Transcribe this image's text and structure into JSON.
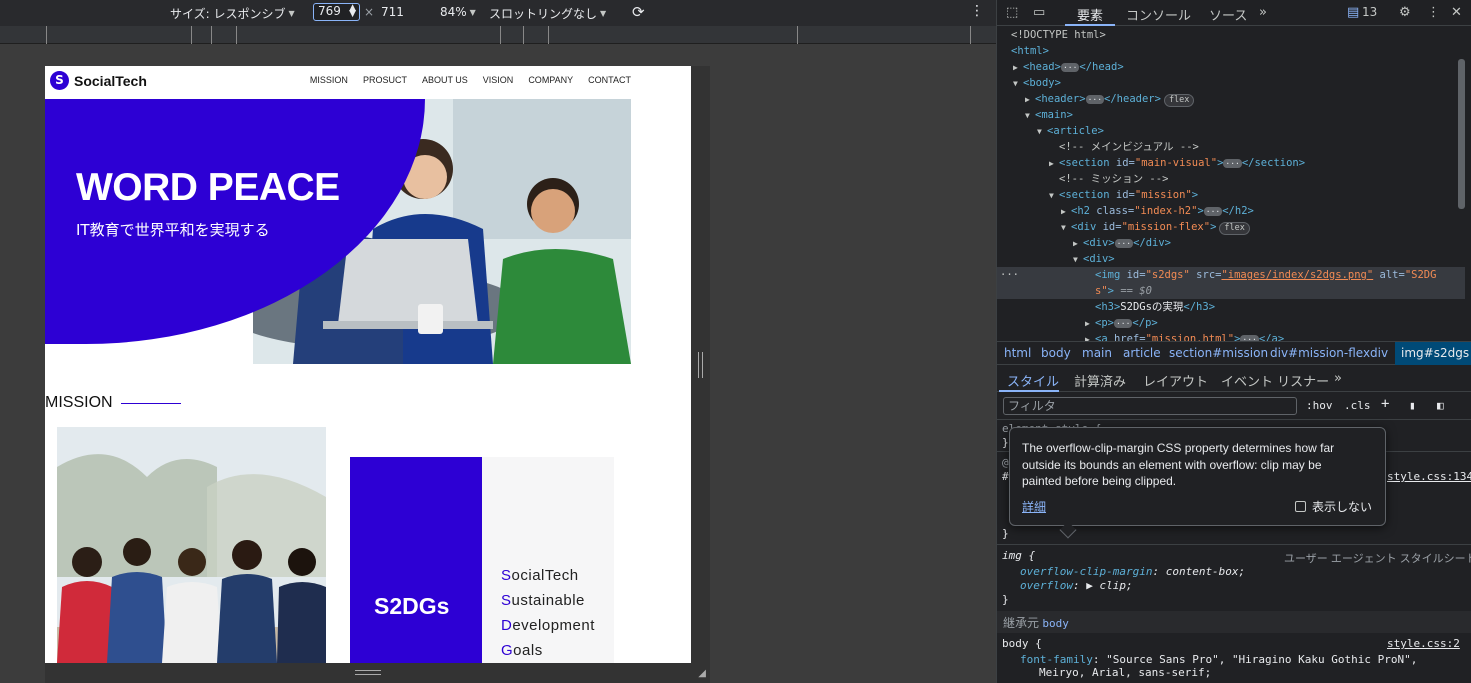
{
  "device_toolbar": {
    "size_label": "サイズ: レスポンシブ",
    "width": "769",
    "height": "711",
    "zoom": "84%",
    "throttle": "スロットリングなし"
  },
  "site": {
    "logo_text": "SocialTech",
    "nav": [
      "MISSION",
      "PROSUCT",
      "ABOUT US",
      "VISION",
      "COMPANY",
      "CONTACT"
    ],
    "hero_title": "WORD PEACE",
    "hero_subtitle": "IT教育で世界平和を実現する",
    "section_title": "MISSION",
    "sdg_title": "S2DGs",
    "sdg_lines": [
      {
        "first": "S",
        "rest": "ocialTech"
      },
      {
        "first": "S",
        "rest": "ustainable"
      },
      {
        "first": "D",
        "rest": "evelopment"
      },
      {
        "first": "G",
        "rest": "oals"
      }
    ]
  },
  "devtools": {
    "tabs": [
      "要素",
      "コンソール",
      "ソース"
    ],
    "issues_count": "13",
    "dom": {
      "doctype": "<!DOCTYPE html>",
      "comment_main_visual": "<!-- メインビジュアル -->",
      "comment_mission": "<!-- ミッション -->",
      "h3_text": "S2DGsの実現",
      "selected_suffix": "== $0"
    },
    "breadcrumbs": [
      "html",
      "body",
      "main",
      "article",
      "section#mission",
      "div#mission-flex",
      "div",
      "img#s2dgs"
    ],
    "sub_tabs": [
      "スタイル",
      "計算済み",
      "レイアウト",
      "イベント リスナー"
    ],
    "filter_placeholder": "フィルタ",
    "hov": ":hov",
    "cls": ".cls",
    "styles": {
      "element_style": "element.style {",
      "src1": "style.css:134",
      "img_selector": "img {",
      "ua_label": "ユーザー エージェント スタイルシート",
      "prop1": "overflow-clip-margin",
      "val1": "content-box;",
      "prop2": "overflow",
      "val2": "clip;",
      "inherited_label": "継承元",
      "inherited_from": "body",
      "body_selector": "body {",
      "src2": "style.css:2",
      "font_prop": "font-family",
      "font_val1": "\"Source Sans Pro\", \"Hiragino Kaku Gothic ProN\",",
      "font_val2": "Meiryo, Arial, sans-serif;"
    },
    "tooltip": {
      "text": "The overflow-clip-margin CSS property determines how far outside its bounds an element with overflow: clip may be painted before being clipped.",
      "learn_more": "詳細",
      "dont_show": "表示しない"
    }
  }
}
